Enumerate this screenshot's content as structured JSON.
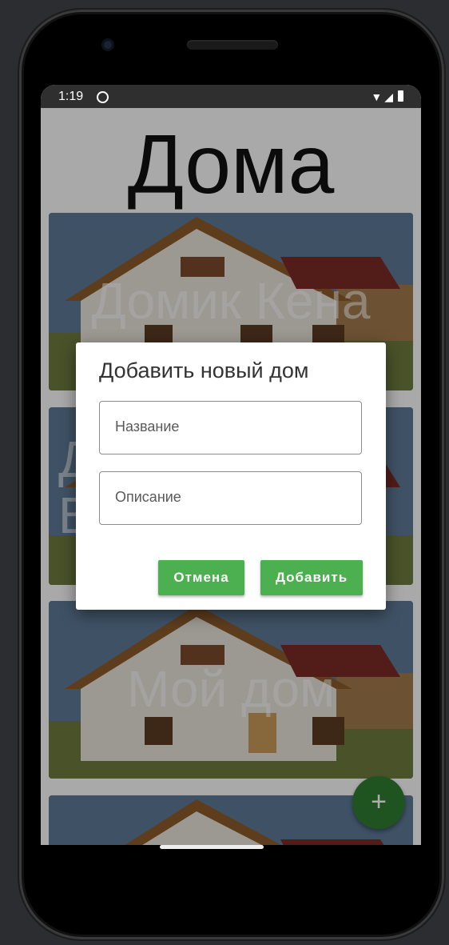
{
  "status_bar": {
    "time": "1:19"
  },
  "page": {
    "title": "Дома"
  },
  "cards": [
    {
      "title": "Домик Кена"
    },
    {
      "title": "Д…\nВ…"
    },
    {
      "title": "Мой дом"
    },
    {
      "title": ""
    }
  ],
  "dialog": {
    "title": "Добавить новый дом",
    "name_placeholder": "Название",
    "name_value": "",
    "description_placeholder": "Описание",
    "description_value": "",
    "cancel_label": "Отмена",
    "add_label": "Добавить"
  },
  "fab": {
    "icon": "plus-icon",
    "glyph": "+",
    "color": "#2e7d32"
  },
  "colors": {
    "accent_button": "#4caf50",
    "fab": "#2e7d32",
    "status_bar": "#2f2f2f"
  }
}
